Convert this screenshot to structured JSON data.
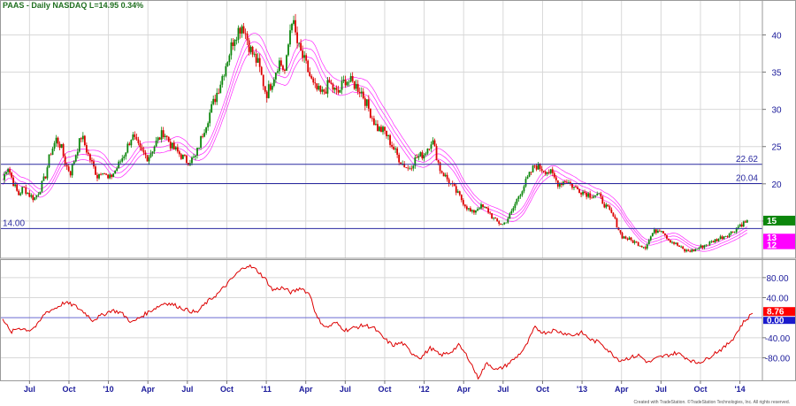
{
  "chart_data": [
    {
      "type": "candlestick",
      "title": "PAAS - Daily  NASDAQ  L=14.95  0.34%",
      "ylim": [
        10,
        43.5
      ],
      "yticks": [
        15,
        20,
        25,
        30,
        35,
        40
      ],
      "grid": true,
      "moving_average_envelope": true,
      "series": [
        {
          "x": [
            2009.33,
            2009.36,
            2009.4,
            2009.43,
            2009.46,
            2009.5,
            2009.53,
            2009.56,
            2009.6,
            2009.63,
            2009.67,
            2009.7,
            2009.73,
            2009.76,
            2009.8,
            2009.83,
            2009.87,
            2009.9,
            2009.93,
            2009.96,
            2010.0,
            2010.05,
            2010.1,
            2010.15,
            2010.2,
            2010.25,
            2010.3,
            2010.35,
            2010.4,
            2010.45,
            2010.5,
            2010.55,
            2010.6,
            2010.65,
            2010.7,
            2010.75,
            2010.8,
            2010.85,
            2010.9,
            2010.95,
            2011.0,
            2011.04,
            2011.08,
            2011.12,
            2011.16,
            2011.2,
            2011.25,
            2011.3,
            2011.35,
            2011.4,
            2011.45,
            2011.5,
            2011.55,
            2011.6,
            2011.65,
            2011.7,
            2011.75,
            2011.8,
            2011.85,
            2011.9,
            2011.95,
            2012.0,
            2012.05,
            2012.1,
            2012.15,
            2012.2,
            2012.25,
            2012.3,
            2012.35,
            2012.4,
            2012.45,
            2012.5,
            2012.55,
            2012.6,
            2012.65,
            2012.7,
            2012.75,
            2012.8,
            2012.85,
            2012.9,
            2012.95,
            2013.0,
            2013.05,
            2013.1,
            2013.15,
            2013.2,
            2013.25,
            2013.3,
            2013.35,
            2013.4,
            2013.45,
            2013.5,
            2013.55,
            2013.6,
            2013.65,
            2013.7,
            2013.75,
            2013.8,
            2013.85,
            2013.9,
            2013.95,
            2014.0,
            2014.05,
            2014.08
          ],
          "close": [
            20.5,
            22.5,
            20.0,
            18.5,
            19.5,
            18.5,
            18.0,
            19.0,
            21.0,
            24.0,
            26.0,
            25.0,
            22.5,
            21.5,
            24.5,
            26.5,
            24.0,
            22.5,
            21.0,
            22.0,
            20.5,
            22.0,
            24.0,
            26.5,
            24.5,
            23.5,
            25.5,
            27.0,
            25.0,
            24.0,
            23.0,
            23.5,
            27.0,
            30.0,
            33.0,
            36.5,
            40.0,
            41.5,
            38.0,
            36.0,
            32.0,
            34.0,
            36.5,
            35.0,
            42.5,
            38.5,
            36.0,
            33.0,
            32.0,
            33.5,
            32.0,
            34.0,
            33.5,
            32.5,
            30.0,
            27.5,
            27.0,
            25.0,
            23.0,
            22.0,
            23.5,
            24.0,
            26.0,
            22.0,
            20.5,
            19.0,
            17.5,
            16.0,
            17.0,
            16.5,
            15.0,
            14.5,
            16.0,
            18.5,
            20.5,
            22.5,
            22.0,
            21.5,
            20.0,
            20.5,
            19.5,
            19.0,
            18.5,
            18.5,
            17.0,
            15.5,
            13.0,
            12.5,
            12.0,
            11.5,
            13.5,
            14.0,
            12.5,
            11.8,
            11.0,
            11.0,
            11.5,
            12.0,
            12.5,
            13.0,
            13.5,
            14.5,
            15.0
          ]
        }
      ],
      "levels": [
        {
          "value": 22.62,
          "label": "22.62"
        },
        {
          "value": 20.04,
          "label": "20.04"
        },
        {
          "value": 14.0,
          "label": "14.00"
        }
      ],
      "badges": [
        {
          "label": "15",
          "color": "#0c860c"
        },
        {
          "label": "13",
          "color": "#ff00ff"
        },
        {
          "label": "12",
          "color": "#ff00ff"
        }
      ]
    },
    {
      "type": "line",
      "ylim": [
        -125,
        115
      ],
      "yticks": [
        80.0,
        40.0,
        -40.0,
        -80.0
      ],
      "zero_line": 0.0,
      "series": [
        {
          "x": [
            2009.33,
            2009.38,
            2009.43,
            2009.5,
            2009.55,
            2009.6,
            2009.67,
            2009.72,
            2009.78,
            2009.85,
            2009.9,
            2009.96,
            2010.02,
            2010.08,
            2010.15,
            2010.22,
            2010.3,
            2010.36,
            2010.42,
            2010.5,
            2010.56,
            2010.62,
            2010.7,
            2010.76,
            2010.82,
            2010.88,
            2010.94,
            2011.0,
            2011.04,
            2011.1,
            2011.16,
            2011.22,
            2011.28,
            2011.32,
            2011.38,
            2011.44,
            2011.5,
            2011.56,
            2011.62,
            2011.68,
            2011.74,
            2011.8,
            2011.86,
            2011.92,
            2011.98,
            2012.04,
            2012.1,
            2012.16,
            2012.22,
            2012.28,
            2012.34,
            2012.4,
            2012.46,
            2012.52,
            2012.58,
            2012.64,
            2012.7,
            2012.76,
            2012.82,
            2012.88,
            2012.94,
            2013.0,
            2013.06,
            2013.12,
            2013.18,
            2013.24,
            2013.3,
            2013.36,
            2013.42,
            2013.48,
            2013.54,
            2013.6,
            2013.66,
            2013.72,
            2013.78,
            2013.84,
            2013.9,
            2013.96,
            2014.02,
            2014.08
          ],
          "values": [
            0,
            -30,
            -20,
            -25,
            -15,
            10,
            20,
            30,
            25,
            10,
            -5,
            5,
            15,
            10,
            -10,
            5,
            20,
            30,
            25,
            15,
            10,
            30,
            50,
            70,
            90,
            105,
            95,
            75,
            55,
            60,
            50,
            60,
            45,
            0,
            -20,
            -10,
            -25,
            -20,
            -15,
            -20,
            -40,
            -55,
            -50,
            -70,
            -80,
            -60,
            -75,
            -70,
            -55,
            -80,
            -120,
            -90,
            -105,
            -95,
            -80,
            -60,
            -20,
            -30,
            -25,
            -30,
            -35,
            -30,
            -45,
            -50,
            -70,
            -85,
            -80,
            -75,
            -90,
            -80,
            -75,
            -70,
            -80,
            -90,
            -85,
            -70,
            -60,
            -40,
            -10,
            8.76
          ]
        }
      ],
      "badges": [
        {
          "label": "8.76",
          "color": "#ff0000"
        },
        {
          "label": "0.00",
          "color": "#1a1acc"
        }
      ]
    }
  ],
  "x_axis": {
    "labels": [
      {
        "text": "Jul",
        "t": 2009.5
      },
      {
        "text": "Oct",
        "t": 2009.75
      },
      {
        "text": "'10",
        "t": 2010.0
      },
      {
        "text": "Apr",
        "t": 2010.25
      },
      {
        "text": "Jul",
        "t": 2010.5
      },
      {
        "text": "Oct",
        "t": 2010.75
      },
      {
        "text": "'11",
        "t": 2011.0
      },
      {
        "text": "Apr",
        "t": 2011.25
      },
      {
        "text": "Jul",
        "t": 2011.5
      },
      {
        "text": "Oct",
        "t": 2011.75
      },
      {
        "text": "'12",
        "t": 2012.0
      },
      {
        "text": "Apr",
        "t": 2012.25
      },
      {
        "text": "Jul",
        "t": 2012.5
      },
      {
        "text": "Oct",
        "t": 2012.75
      },
      {
        "text": "'13",
        "t": 2013.0
      },
      {
        "text": "Apr",
        "t": 2013.25
      },
      {
        "text": "Jul",
        "t": 2013.5
      },
      {
        "text": "Oct",
        "t": 2013.75
      },
      {
        "text": "'14",
        "t": 2014.0
      }
    ],
    "range": [
      2009.33,
      2014.12
    ]
  },
  "footer": {
    "credit": "Created with TradeStation. ©TradeStation Technologies, Inc. All rights reserved."
  },
  "colors": {
    "up": "#0c860c",
    "down": "#dd0000",
    "ma": "#ff00ff",
    "level_line": "#2a2aa0",
    "grid": "#d8d8d8",
    "indicator": "#dd0000"
  }
}
